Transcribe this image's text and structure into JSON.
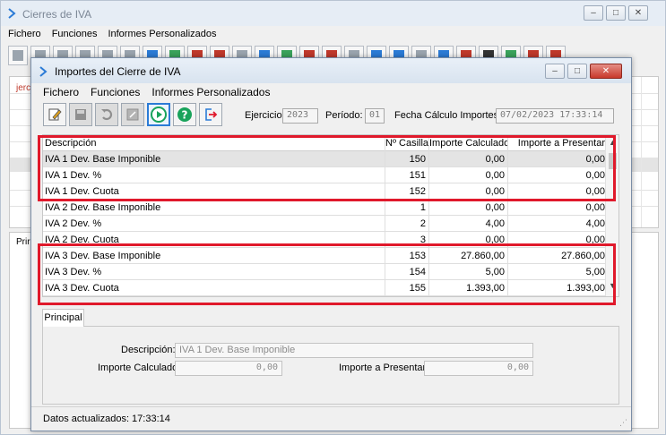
{
  "bg_window": {
    "title": "Cierres de IVA",
    "menu": [
      "Fichero",
      "Funciones",
      "Informes Personalizados"
    ],
    "grid_fragment": "jerc",
    "lower_tab_fragment": "Prir"
  },
  "dialog": {
    "title": "Importes del Cierre de IVA",
    "menu": [
      "Fichero",
      "Funciones",
      "Informes Personalizados"
    ],
    "toolbar_icons": [
      "edit-icon",
      "save-icon",
      "undo-icon",
      "calculator-icon",
      "play-icon",
      "help-icon",
      "exit-icon"
    ],
    "filters": {
      "ejercicio_label": "Ejercicio:",
      "ejercicio_value": "2023",
      "periodo_label": "Período:",
      "periodo_value": "01",
      "fecha_label": "Fecha Cálculo Importes:",
      "fecha_value": "07/02/2023 17:33:14"
    },
    "grid": {
      "columns": [
        "Descripción",
        "Nº Casilla",
        "Importe Calculado",
        "Importe a Presentar"
      ],
      "rows": [
        {
          "desc": "IVA 1 Dev. Base Imponible",
          "casilla": "150",
          "calc": "0,00",
          "pres": "0,00"
        },
        {
          "desc": "IVA 1 Dev. %",
          "casilla": "151",
          "calc": "0,00",
          "pres": "0,00"
        },
        {
          "desc": "IVA 1 Dev. Cuota",
          "casilla": "152",
          "calc": "0,00",
          "pres": "0,00"
        },
        {
          "desc": "IVA 2 Dev. Base Imponible",
          "casilla": "1",
          "calc": "0,00",
          "pres": "0,00"
        },
        {
          "desc": "IVA 2 Dev. %",
          "casilla": "2",
          "calc": "4,00",
          "pres": "4,00"
        },
        {
          "desc": "IVA 2 Dev. Cuota",
          "casilla": "3",
          "calc": "0,00",
          "pres": "0,00"
        },
        {
          "desc": "IVA 3 Dev. Base Imponible",
          "casilla": "153",
          "calc": "27.860,00",
          "pres": "27.860,00"
        },
        {
          "desc": "IVA 3 Dev. %",
          "casilla": "154",
          "calc": "5,00",
          "pres": "5,00"
        },
        {
          "desc": "IVA 3 Dev. Cuota",
          "casilla": "155",
          "calc": "1.393,00",
          "pres": "1.393,00"
        }
      ]
    },
    "detail": {
      "tab_label": "Principal",
      "descripcion_label": "Descripción:",
      "descripcion_value": "IVA 1 Dev. Base Imponible",
      "calc_label": "Importe Calculado:",
      "calc_value": "0,00",
      "pres_label": "Importe a Presentar:",
      "pres_value": "0,00"
    },
    "status": "Datos actualizados: 17:33:14"
  },
  "colors": {
    "highlight": "#e0192b",
    "accent": "#2b7bd6",
    "selected_row": "#e4e4e4"
  }
}
